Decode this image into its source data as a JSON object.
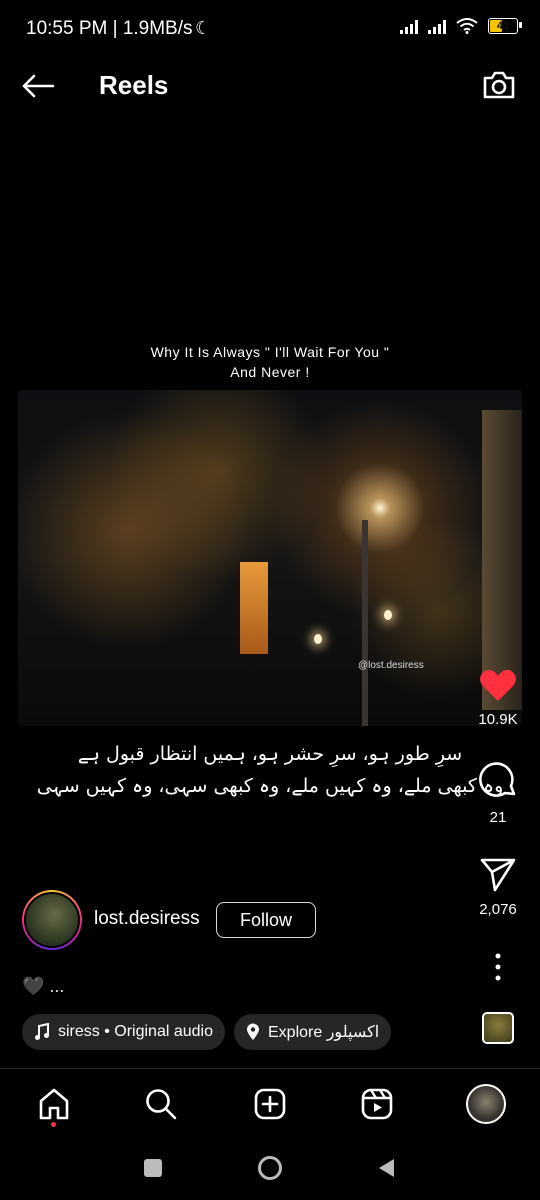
{
  "status_bar": {
    "time_speed": "10:55 PM | 1.9MB/s",
    "battery_level": "42"
  },
  "header": {
    "title": "Reels",
    "back_icon": "arrow-left-icon",
    "camera_icon": "camera-icon"
  },
  "reel": {
    "caption_top_line1": "Why It Is Always \" I'll Wait For You \"",
    "caption_top_line2": "And Never !",
    "watermark": "@lost.desiress",
    "caption_urdu_line1": "سرِ طور ہو، سرِ حشر ہو، ہمیں انتظار قبول ہے",
    "caption_urdu_line2": "وہ کبھی ملے، وہ کہیں ملے، وہ کبھی سہی، وہ کہیں سہی"
  },
  "actions": {
    "likes": "10.9K",
    "comments": "21",
    "shares": "2,076",
    "like_color": "#ff3040"
  },
  "author": {
    "username": "lost.desiress",
    "follow_label": "Follow",
    "description": "🖤 ..."
  },
  "audio": {
    "label": "siress • Original audio",
    "location_label": "Explore اکسپلور"
  },
  "bottom_nav": {
    "items": [
      "home-icon",
      "search-icon",
      "create-icon",
      "reels-icon",
      "profile-avatar"
    ]
  }
}
